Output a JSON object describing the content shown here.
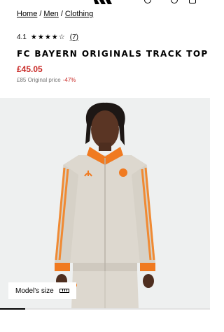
{
  "breadcrumb": {
    "items": [
      "Home",
      "Men",
      "Clothing"
    ],
    "separator": "/"
  },
  "rating": {
    "score": "4.1",
    "stars": "★★★★☆",
    "count": "(7)"
  },
  "product": {
    "title": "FC BAYERN ORIGINALS TRACK TOP",
    "price": "£45.05",
    "original_price": "£85 Original price",
    "discount": "-47%"
  },
  "image": {
    "model_size_label": "Model's size",
    "gallery_progress": 0.12
  },
  "colors": {
    "sale": "#c92b28",
    "jacket": "#ddd8cf",
    "accent": "#f07a20",
    "background": "#eef0f0"
  },
  "icons": [
    "adidas-logo-icon",
    "user-icon",
    "search-icon",
    "bag-icon",
    "ruler-icon"
  ]
}
